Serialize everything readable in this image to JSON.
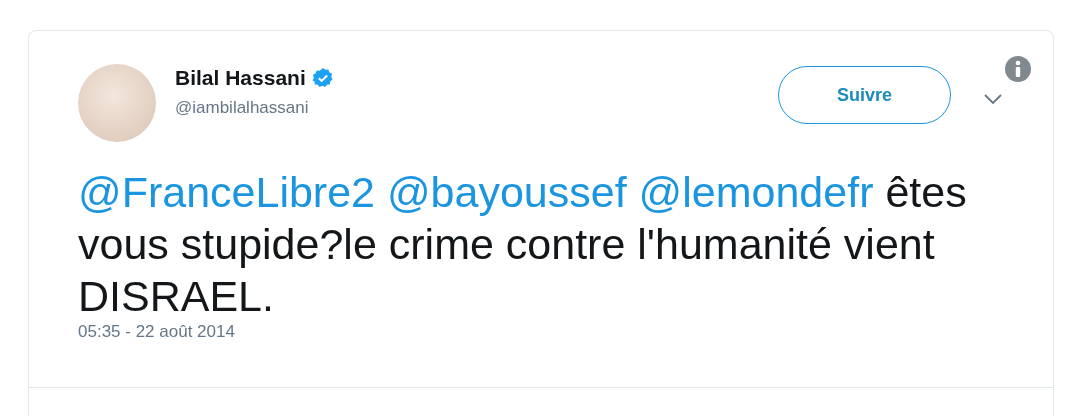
{
  "tweet": {
    "author": {
      "name": "Bilal Hassani",
      "verified": true,
      "handle": "@iambilalhassani"
    },
    "follow_button": "Suivre",
    "text": [
      {
        "kind": "mention",
        "text": "@FranceLibre2 "
      },
      {
        "kind": "mention",
        "text": "@bayoussef "
      },
      {
        "kind": "mention",
        "text": "@lemondefr"
      },
      {
        "kind": "text",
        "text": " êtes vous stupide?le crime contre l'humanité vient DISRAEL."
      }
    ],
    "timestamp": "05:35 - 22 août 2014"
  }
}
